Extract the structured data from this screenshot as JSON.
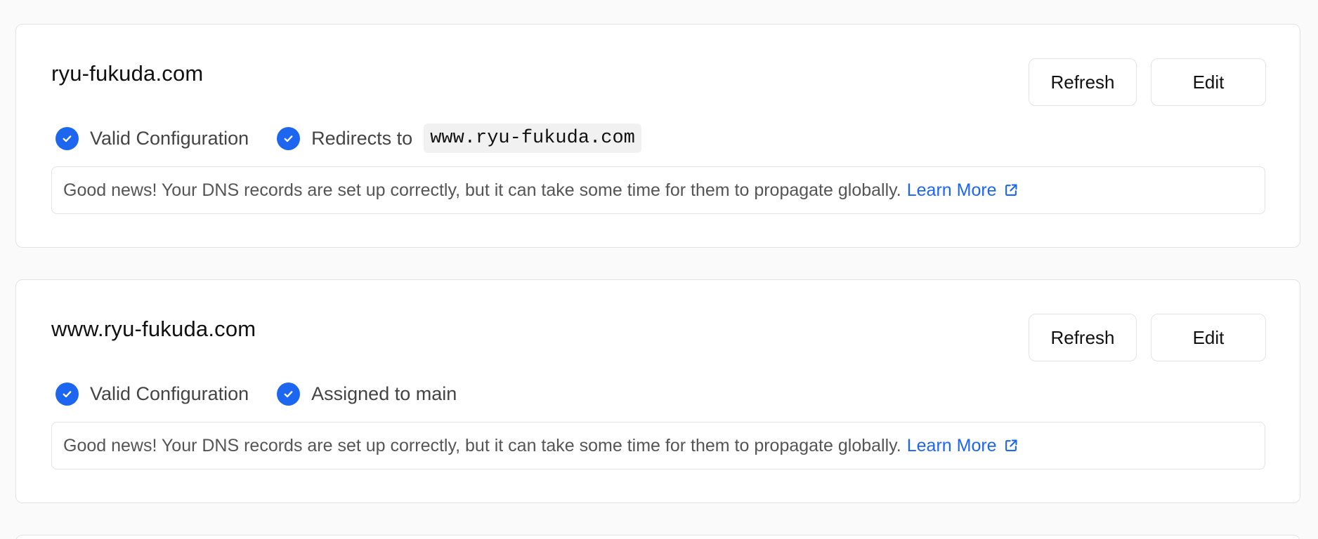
{
  "domains": [
    {
      "name": "ryu-fukuda.com",
      "refresh_label": "Refresh",
      "edit_label": "Edit",
      "status_valid": "Valid Configuration",
      "status_second": "Redirects to",
      "redirect_target": "www.ryu-fukuda.com",
      "info_text": "Good news! Your DNS records are set up correctly, but it can take some time for them to propagate globally.",
      "learn_more": "Learn More"
    },
    {
      "name": "www.ryu-fukuda.com",
      "refresh_label": "Refresh",
      "edit_label": "Edit",
      "status_valid": "Valid Configuration",
      "status_second": "Assigned to main",
      "info_text": "Good news! Your DNS records are set up correctly, but it can take some time for them to propagate globally.",
      "learn_more": "Learn More"
    }
  ],
  "colors": {
    "accent": "#1d66f0",
    "border": "#e3e3e3",
    "background": "#fafafa"
  },
  "icons": {
    "status": "check-circle-icon",
    "link": "external-link-icon"
  }
}
